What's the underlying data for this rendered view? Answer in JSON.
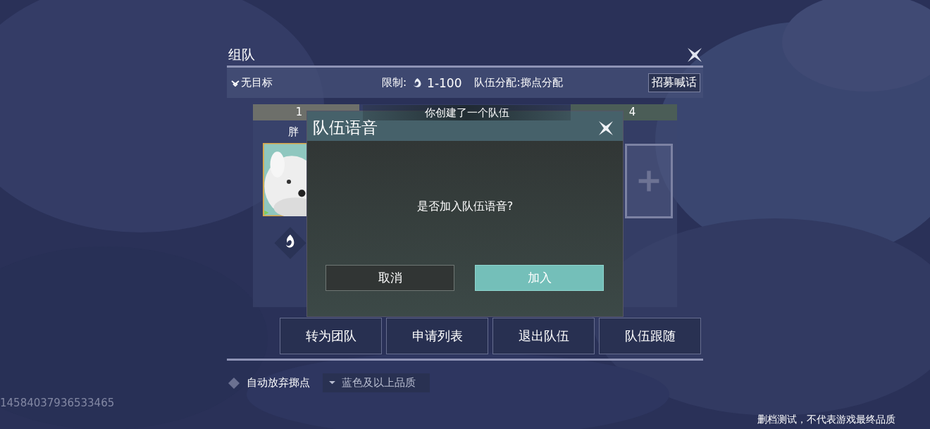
{
  "panel": {
    "title": "组队",
    "target": "无目标",
    "limit_label": "限制:",
    "level_range": "1-100",
    "distribution": "队伍分配:掷点分配",
    "recruit_button": "招募喊话"
  },
  "slots": [
    {
      "number": "1",
      "kind": "member",
      "name": "胖"
    },
    {
      "number": "4",
      "kind": "empty"
    }
  ],
  "actions": [
    "转为团队",
    "申请列表",
    "退出队伍",
    "队伍跟随"
  ],
  "auto_discard": {
    "label": "自动放弃掷点",
    "checked": false
  },
  "quality_dropdown": {
    "value": "蓝色及以上品质"
  },
  "user_id": "14584037936533465",
  "disclaimer": "删档测试，不代表游戏最终品质",
  "toast": "你创建了一个队伍",
  "dialog": {
    "title": "队伍语音",
    "message": "是否加入队伍语音?",
    "buttons": [
      {
        "label": "取消",
        "kind": "secondary"
      },
      {
        "label": "加入",
        "kind": "primary"
      }
    ]
  }
}
